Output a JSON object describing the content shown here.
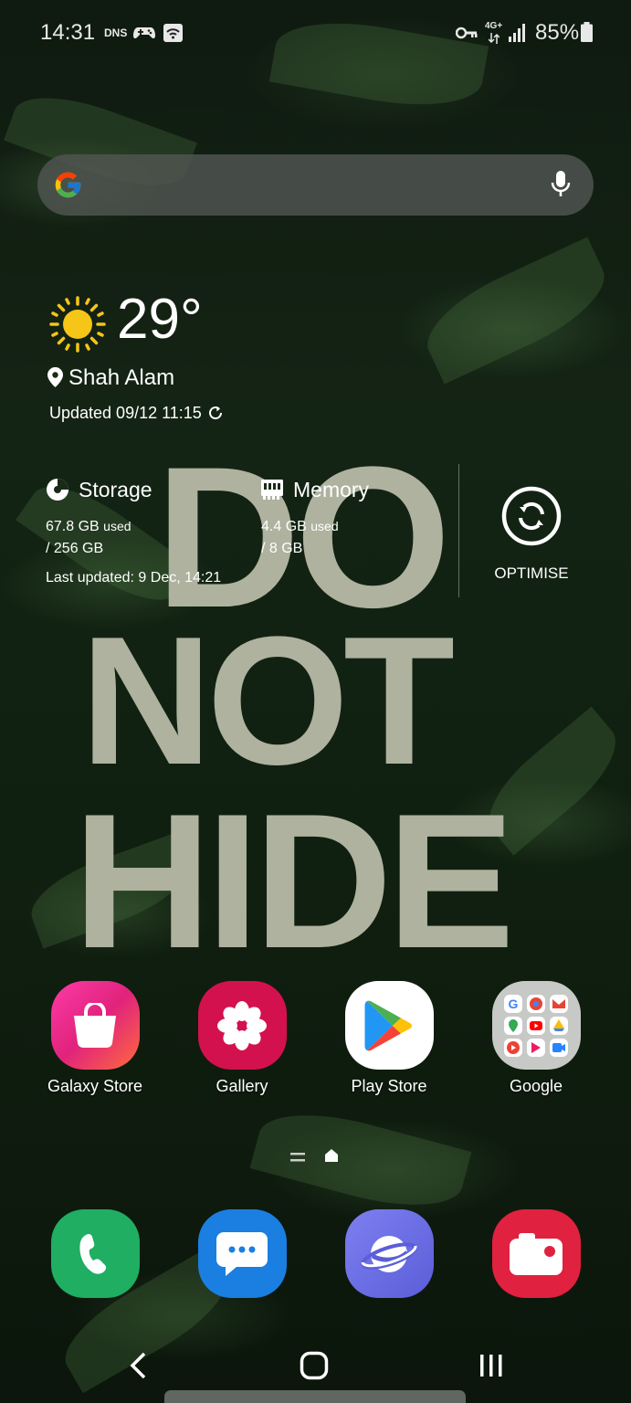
{
  "status_bar": {
    "time": "14:31",
    "carrier_tag": "DNS",
    "network": "4G+",
    "battery": "85%",
    "icons": [
      "gamepad-icon",
      "wifi-calling-icon",
      "vpn-key-icon",
      "network-arrows-icon",
      "signal-icon",
      "battery-icon"
    ]
  },
  "search": {
    "placeholder": "",
    "icons": [
      "google-g-icon",
      "mic-icon"
    ]
  },
  "weather": {
    "temperature": "29°",
    "location": "Shah Alam",
    "updated": "Updated 09/12 11:15",
    "icon": "sun-icon"
  },
  "wallpaper_text": [
    "DO",
    "NOT",
    "HIDE"
  ],
  "device_care": {
    "storage_label": "Storage",
    "storage_used": "67.8 GB",
    "storage_total": "/ 256 GB",
    "memory_label": "Memory",
    "memory_used": "4.4 GB",
    "memory_total": "/ 8 GB",
    "used_word": "used",
    "last_updated": "Last updated: 9 Dec, 14:21",
    "optimise_label": "OPTIMISE"
  },
  "home_apps": [
    {
      "label": "Galaxy Store",
      "icon": "shopping-bag-icon",
      "color": "#e0237c"
    },
    {
      "label": "Gallery",
      "icon": "flower-icon",
      "color": "#d3114e"
    },
    {
      "label": "Play Store",
      "icon": "play-store-icon",
      "color": "#ffffff"
    },
    {
      "label": "Google",
      "icon": "google-folder-icon",
      "color": "#cfcfcf"
    }
  ],
  "dock_apps": [
    {
      "name": "phone",
      "icon": "phone-icon",
      "color": "#1fae62"
    },
    {
      "name": "messages",
      "icon": "message-icon",
      "color": "#1a7fe0"
    },
    {
      "name": "internet",
      "icon": "planet-icon",
      "color": "#6c6fe6"
    },
    {
      "name": "camera",
      "icon": "camera-icon",
      "color": "#e0213f"
    }
  ],
  "nav": {
    "back": "back-icon",
    "home": "home-icon",
    "recents": "recents-icon"
  }
}
